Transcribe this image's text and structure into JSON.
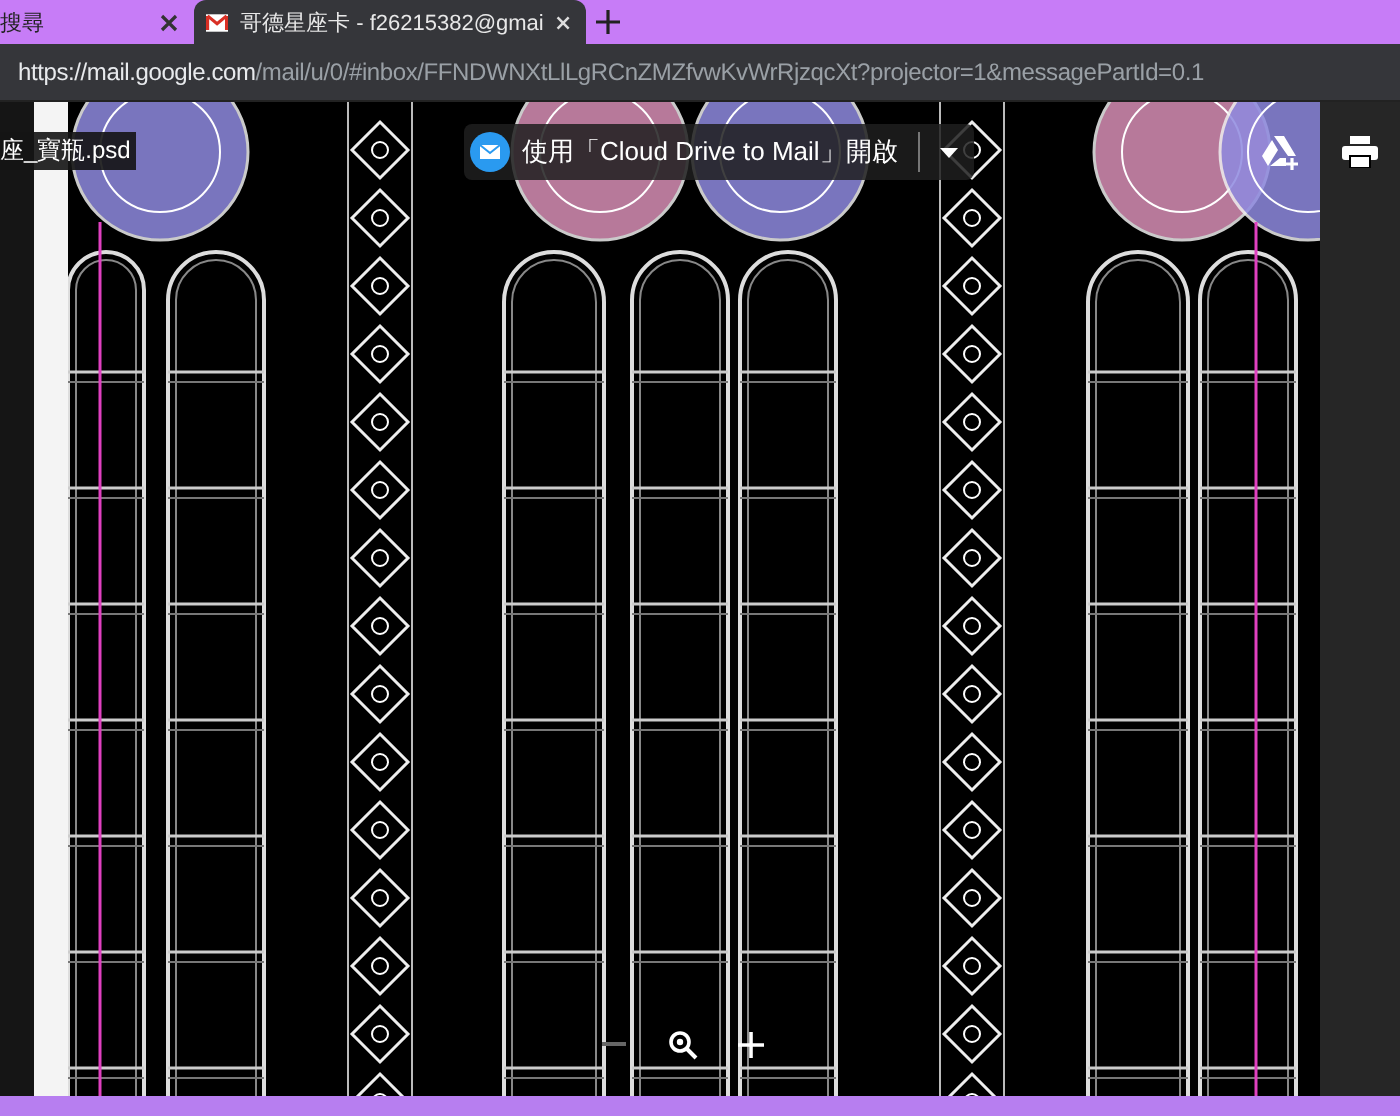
{
  "browser": {
    "tabs": [
      {
        "title": "搜尋",
        "selected": false
      },
      {
        "title": "哥德星座卡 - f26215382@gmai",
        "selected": true
      }
    ]
  },
  "address_bar": {
    "url_host": "https://mail.google.com",
    "url_path": "/mail/u/0/#inbox/FFNDWNXtLlLgRCnZMZfvwKvWrRjzqcXt?projector=1&messagePartId=0.1"
  },
  "viewer": {
    "file_name": "座_寶瓶.psd",
    "open_with": "使用「Cloud Drive to Mail」開啟"
  }
}
